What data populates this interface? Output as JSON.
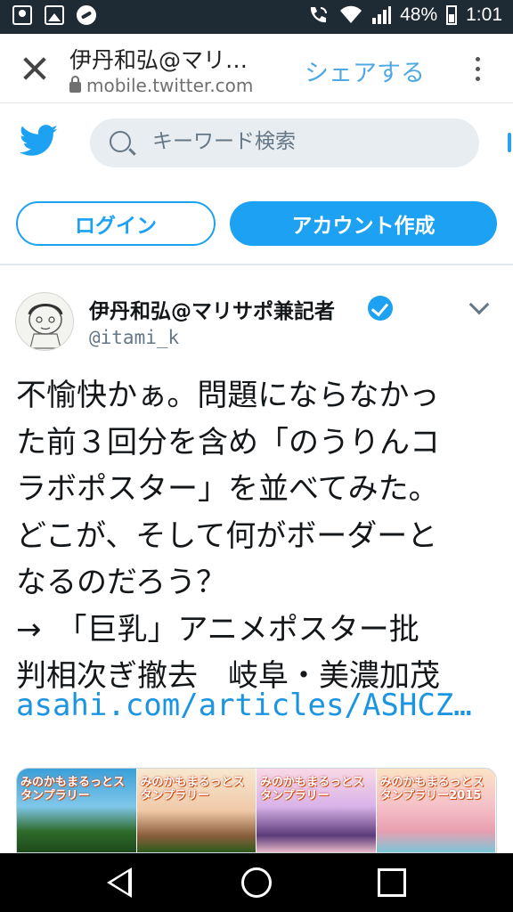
{
  "status_bar": {
    "battery": "48%",
    "time": "1:01",
    "left_icons": [
      "contact-icon",
      "picture-icon",
      "app-icon"
    ],
    "right_icons": [
      "wifi-calling-icon",
      "wifi-icon",
      "signal-icon",
      "battery-icon"
    ]
  },
  "browser": {
    "title": "伊丹和弘@マリ…",
    "url": "mobile.twitter.com",
    "share_label": "シェアする"
  },
  "twitter": {
    "search_placeholder": "キーワード検索",
    "login_label": "ログイン",
    "signup_label": "アカウント作成",
    "brand_color": "#1DA1F2"
  },
  "tweet": {
    "author_name": "伊丹和弘@マリサポ兼記者",
    "handle": "@itami_k",
    "text_lines": [
      "不愉快かぁ。問題にならなかっ",
      "た前３回分を含め「のうりんコ",
      "ラボポスター」を並べてみた。",
      "どこが、そして何がボーダーと",
      "なるのだろう？",
      "→　「巨乳」アニメポスター批",
      "判相次ぎ撤去　岐阜・美濃加茂"
    ],
    "link": "asahi.com/articles/ASHCZ…",
    "link_color": "#1B95E0"
  },
  "media": {
    "posters": [
      {
        "title": "みのかもまるっとスタンプラリー"
      },
      {
        "title": "みのかもまるっとスタンプラリー"
      },
      {
        "title": "みのかもまるっとスタンプラリー"
      },
      {
        "title": "みのかもまるっとスタンプラリー2015"
      }
    ]
  },
  "nav": {
    "icons": [
      "back-icon",
      "home-icon",
      "recents-icon"
    ]
  }
}
